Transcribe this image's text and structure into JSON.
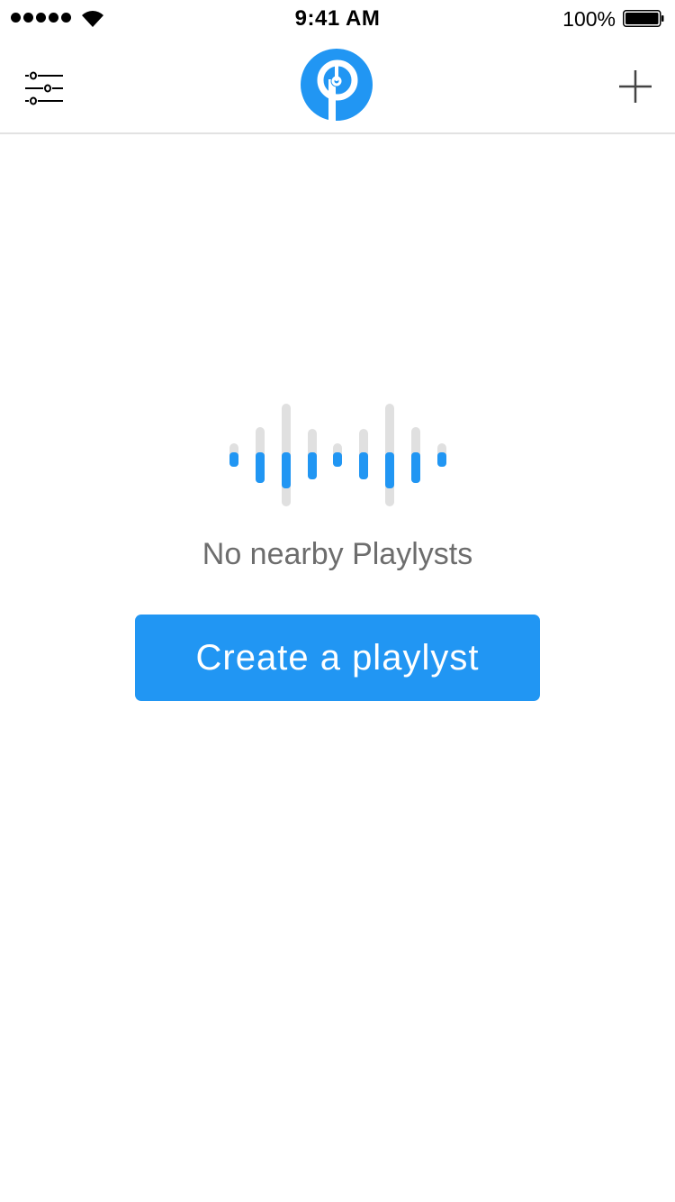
{
  "status_bar": {
    "time": "9:41 AM",
    "battery_percent": "100%",
    "signal_bars": 5,
    "signal_icon": "cellular-signal-icon",
    "wifi_icon": "wifi-icon",
    "battery_icon": "battery-full-icon"
  },
  "nav_bar": {
    "left_icon": "sliders-filter-icon",
    "logo_icon": "playlyst-logo-icon",
    "right_icon": "plus-icon"
  },
  "empty_state": {
    "illustration_icon": "sound-wave-icon",
    "message": "No nearby Playlysts",
    "button_label": "Create a playlyst"
  },
  "colors": {
    "accent": "#2196f3",
    "wave_inactive": "#e0e0e0",
    "message_text": "#6d6d6d",
    "divider": "#e2e2e2"
  }
}
